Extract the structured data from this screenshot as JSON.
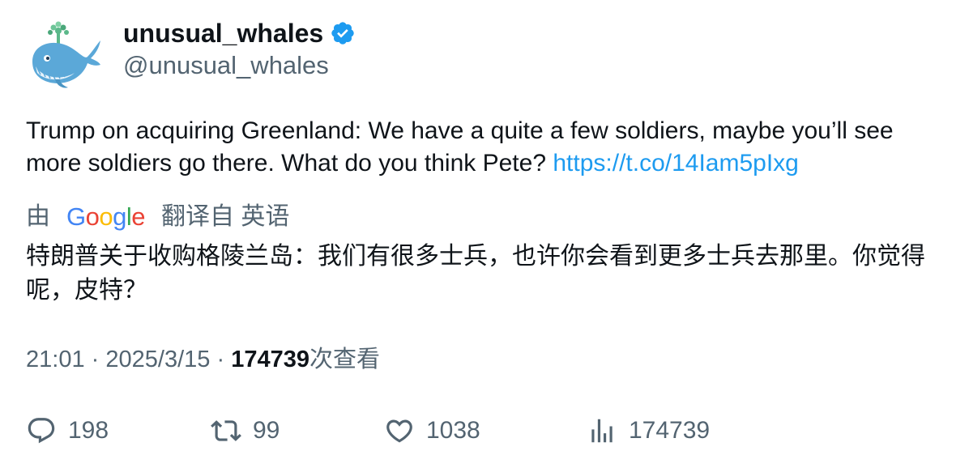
{
  "author": {
    "display_name": "unusual_whales",
    "handle": "@unusual_whales",
    "verified": true,
    "avatar_icon": "whale-avatar-icon",
    "verified_icon": "verified-badge-icon"
  },
  "tweet": {
    "text": "Trump on acquiring Greenland: We have a quite a few soldiers, maybe you’ll see more soldiers go there. What do you think Pete?",
    "link": "https://t.co/14Iam5pIxg"
  },
  "translation": {
    "prefix": "由",
    "provider": "Google",
    "suffix": "翻译自 英语",
    "text": "特朗普关于收购格陵兰岛：我们有很多士兵，也许你会看到更多士兵去那里。你觉得呢，皮特？"
  },
  "meta": {
    "time": "21:01",
    "separator": "·",
    "date": "2025/3/15",
    "views_count": "174739",
    "views_label": "次查看"
  },
  "actions": {
    "replies": "198",
    "retweets": "99",
    "likes": "1038",
    "views": "174739"
  },
  "colors": {
    "link": "#1d9bf0",
    "secondary_text": "#536471",
    "primary_text": "#0f1419",
    "verified": "#1d9bf0"
  }
}
